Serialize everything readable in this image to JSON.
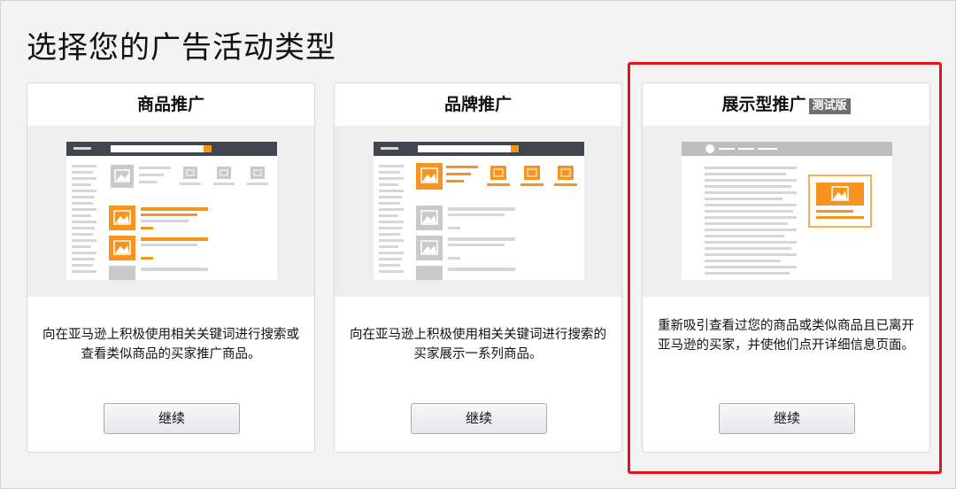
{
  "page": {
    "title": "选择您的广告活动类型"
  },
  "cards": [
    {
      "title": "商品推广",
      "description": "向在亚马逊上积极使用相关关键词进行搜索或查看类似商品的买家推广商品。",
      "button_label": "继续"
    },
    {
      "title": "品牌推广",
      "description": "向在亚马逊上积极使用相关关键词进行搜索的买家展示一系列商品。",
      "button_label": "继续"
    },
    {
      "title": "展示型推广",
      "badge": "测试版",
      "description": "重新吸引查看过您的商品或类似商品且已离开亚马逊的买家，并使他们点开详细信息页面。",
      "button_label": "继续"
    }
  ],
  "colors": {
    "accent": "#f7941d",
    "highlight_border": "#e4141a",
    "nav_dark": "#3f4650"
  }
}
